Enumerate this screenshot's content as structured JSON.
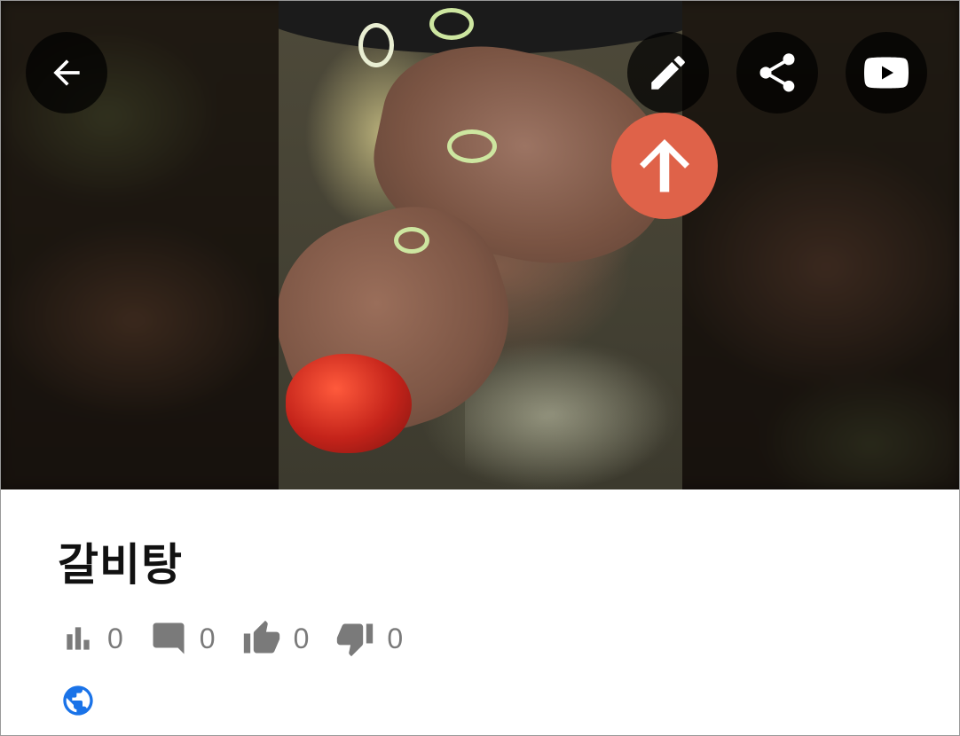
{
  "post": {
    "title": "갈비탕"
  },
  "stats": {
    "views": "0",
    "comments": "0",
    "likes": "0",
    "dislikes": "0"
  },
  "colors": {
    "upvote_accent": "#df6249",
    "overlay_button": "#000000",
    "stat_icon": "#7a7a7a",
    "globe": "#1a73e8"
  },
  "icons": {
    "back": "arrow-left-icon",
    "edit": "pencil-icon",
    "share": "share-icon",
    "youtube": "youtube-icon",
    "upvote": "arrow-up-icon",
    "views": "bar-chart-icon",
    "comments": "comment-icon",
    "likes": "thumb-up-icon",
    "dislikes": "thumb-down-icon",
    "visibility": "globe-icon"
  }
}
